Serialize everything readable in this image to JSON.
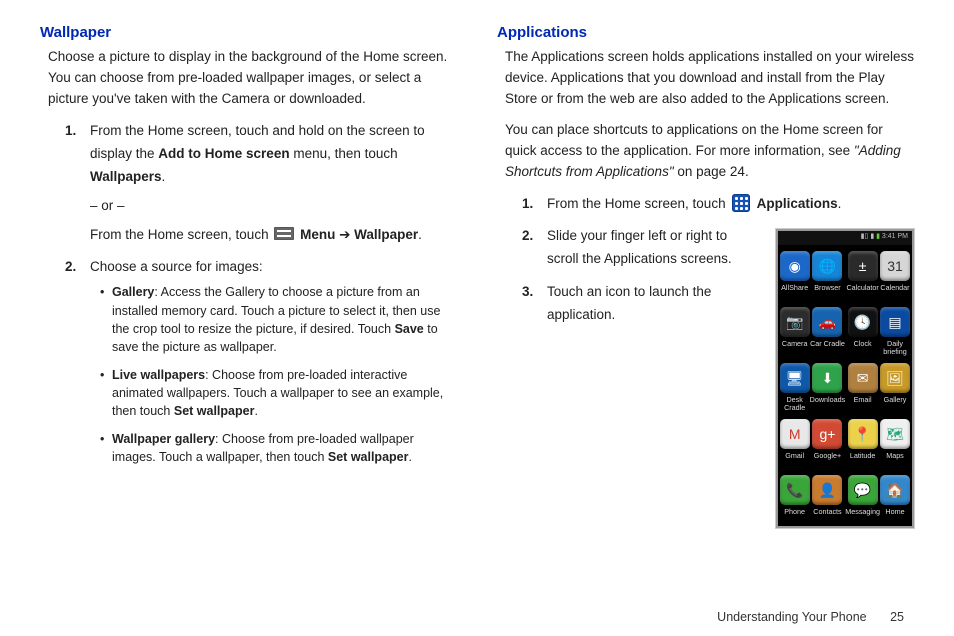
{
  "left": {
    "heading": "Wallpaper",
    "intro": "Choose a picture to display in the background of the Home screen. You can choose from pre-loaded wallpaper images, or select a picture you've taken with the Camera or downloaded.",
    "step1_a": "From the Home screen, touch and hold on the screen to display the ",
    "step1_b": "Add to Home screen",
    "step1_c": " menu, then touch ",
    "step1_d": "Wallpapers",
    "step1_e": ".",
    "or": "– or –",
    "step1_f": "From the Home screen, touch ",
    "step1_g": " Menu ",
    "arrow": "➔",
    "step1_h": " Wallpaper",
    "step1_i": ".",
    "step2": "Choose a source for images:",
    "bullets": [
      {
        "t": "Gallery",
        "d": ": Access the Gallery to choose a picture from an installed memory card. Touch a picture to select it, then use the crop tool to resize the picture, if desired. Touch ",
        "b2": "Save",
        "d2": " to save the picture as wallpaper."
      },
      {
        "t": "Live wallpapers",
        "d": ": Choose from pre-loaded interactive animated wallpapers. Touch a wallpaper to see an example, then touch ",
        "b2": "Set wallpaper",
        "d2": "."
      },
      {
        "t": "Wallpaper gallery",
        "d": ": Choose from pre-loaded wallpaper images. Touch a wallpaper, then touch ",
        "b2": "Set wallpaper",
        "d2": "."
      }
    ]
  },
  "right": {
    "heading": "Applications",
    "intro1": "The Applications screen holds applications installed on your wireless device. Applications that you download and install from the Play Store or from the web are also added to the Applications screen.",
    "intro2a": "You can place shortcuts to applications on the Home screen for quick access to the application. For more information, see ",
    "intro2b": "\"Adding Shortcuts from Applications\"",
    "intro2c": " on page 24.",
    "step1_a": "From the Home screen, touch ",
    "step1_b": " Applications",
    "step1_c": ".",
    "step2": "Slide your finger left or right to scroll the Applications screens.",
    "step3": "Touch an icon to launch the application."
  },
  "phone": {
    "status_time": "3:41 PM",
    "apps": [
      {
        "label": "AllShare",
        "bg": "#1b68c9",
        "glyph": "◉"
      },
      {
        "label": "Browser",
        "bg": "#1784d6",
        "glyph": "🌐"
      },
      {
        "label": "Calculator",
        "bg": "#2a2a2a",
        "glyph": "±"
      },
      {
        "label": "Calendar",
        "bg": "#d6d6d6",
        "glyph": "31",
        "fg": "#333"
      },
      {
        "label": "Camera",
        "bg": "#2c2c2c",
        "glyph": "📷"
      },
      {
        "label": "Car Cradle",
        "bg": "#1664b0",
        "glyph": "🚗"
      },
      {
        "label": "Clock",
        "bg": "#111",
        "glyph": "🕓"
      },
      {
        "label": "Daily\nbriefing",
        "bg": "#0a4aa0",
        "glyph": "▤"
      },
      {
        "label": "Desk Cradle",
        "bg": "#0e58aa",
        "glyph": "🖥"
      },
      {
        "label": "Downloads",
        "bg": "#2fa34a",
        "glyph": "⬇"
      },
      {
        "label": "Email",
        "bg": "#b08040",
        "glyph": "✉"
      },
      {
        "label": "Gallery",
        "bg": "#c79a28",
        "glyph": "🖼"
      },
      {
        "label": "Gmail",
        "bg": "#e8e8e8",
        "glyph": "M",
        "fg": "#cc3b2e"
      },
      {
        "label": "Google+",
        "bg": "#d24a33",
        "glyph": "g+"
      },
      {
        "label": "Latitude",
        "bg": "#ecd24a",
        "glyph": "📍",
        "fg": "#c0392b"
      },
      {
        "label": "Maps",
        "bg": "#f0f0f0",
        "glyph": "🗺",
        "fg": "#2a7"
      },
      {
        "label": "Phone",
        "bg": "#3aa63a",
        "glyph": "📞"
      },
      {
        "label": "Contacts",
        "bg": "#c97b2e",
        "glyph": "👤"
      },
      {
        "label": "Messaging",
        "bg": "#3aa63a",
        "glyph": "💬"
      },
      {
        "label": "Home",
        "bg": "#3388cc",
        "glyph": "🏠"
      }
    ]
  },
  "footer": {
    "section": "Understanding Your Phone",
    "page": "25"
  }
}
